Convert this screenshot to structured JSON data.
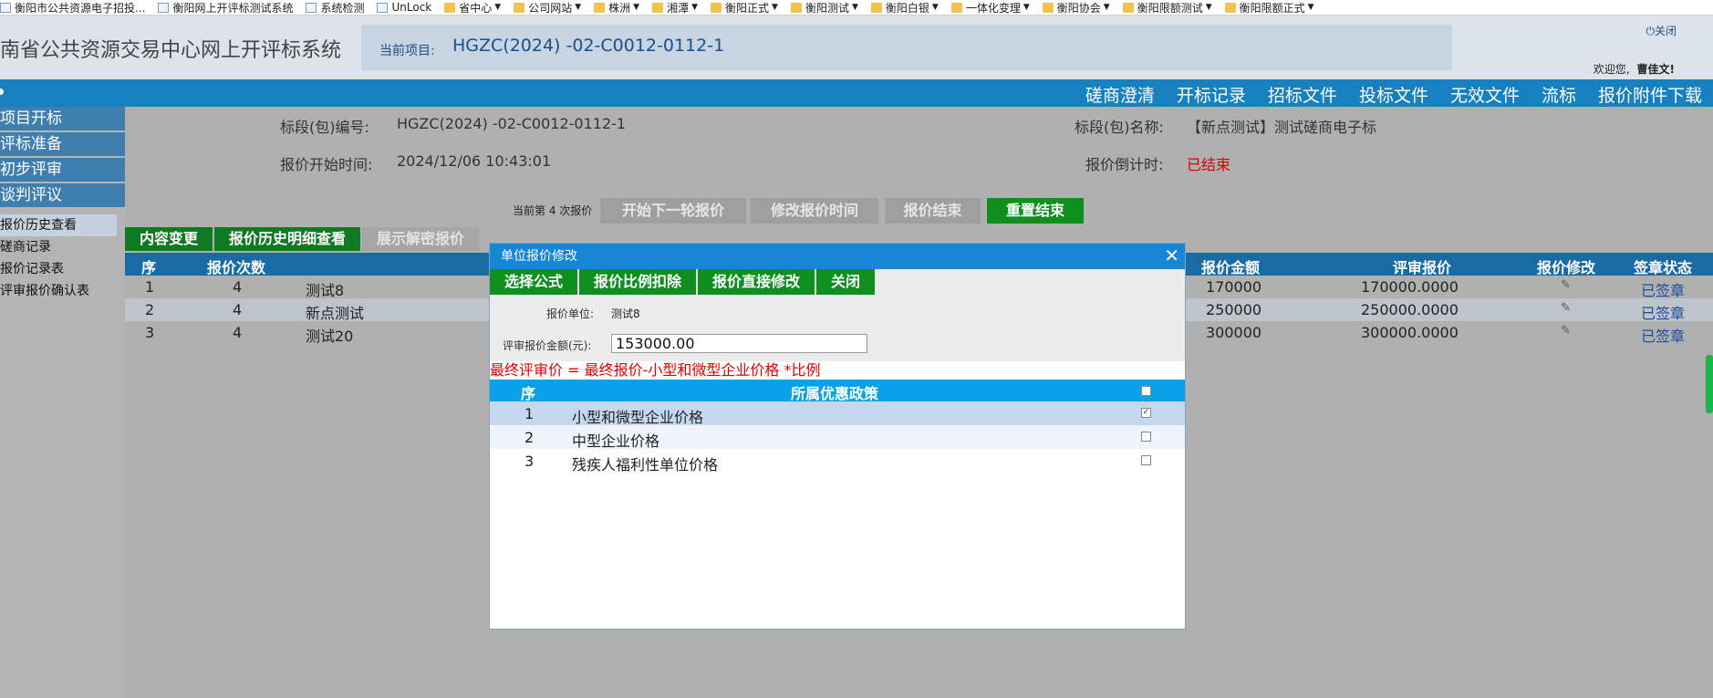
{
  "bookmarks": [
    {
      "label": "衡阳市公共资源电子招投...",
      "type": "page",
      "dropdown": false
    },
    {
      "label": "衡阳网上开评标测试系统",
      "type": "page",
      "dropdown": false
    },
    {
      "label": "系统检测",
      "type": "page",
      "dropdown": false
    },
    {
      "label": "UnLock",
      "type": "page",
      "dropdown": false
    },
    {
      "label": "省中心",
      "type": "folder",
      "dropdown": true
    },
    {
      "label": "公司网站",
      "type": "folder",
      "dropdown": true
    },
    {
      "label": "株洲",
      "type": "folder",
      "dropdown": true
    },
    {
      "label": "湘潭",
      "type": "folder",
      "dropdown": true
    },
    {
      "label": "衡阳正式",
      "type": "folder",
      "dropdown": true
    },
    {
      "label": "衡阳测试",
      "type": "folder",
      "dropdown": true
    },
    {
      "label": "衡阳白银",
      "type": "folder",
      "dropdown": true
    },
    {
      "label": "一体化变理",
      "type": "folder",
      "dropdown": true
    },
    {
      "label": "衡阳协会",
      "type": "folder",
      "dropdown": true
    },
    {
      "label": "衡阳限额测试",
      "type": "folder",
      "dropdown": true
    },
    {
      "label": "衡阳限额正式",
      "type": "folder",
      "dropdown": true
    }
  ],
  "header": {
    "system_title": "南省公共资源交易中心网上开评标系统",
    "project_label": "当前项目:",
    "project_code": "HGZC(2024) -02-C0012-0112-1",
    "close_label": "关闭",
    "welcome_label": "欢迎您,",
    "user_name": "曹佳文!"
  },
  "topnav": [
    "磋商澄清",
    "开标记录",
    "招标文件",
    "投标文件",
    "无效文件",
    "流标",
    "报价附件下载"
  ],
  "sidebar": {
    "sections": [
      "项目开标",
      "评标准备",
      "初步评审",
      "谈判评议"
    ],
    "links": [
      "报价历史查看",
      "磋商记录",
      "报价记录表",
      "评审报价确认表"
    ],
    "active_index": 0
  },
  "info": {
    "package_code_label": "标段(包)编号:",
    "package_code": "HGZC(2024) -02-C0012-0112-1",
    "package_name_label": "标段(包)名称:",
    "package_name": "【新点测试】测试磋商电子标",
    "start_time_label": "报价开始时间:",
    "start_time": "2024/12/06 10:43:01",
    "countdown_label": "报价倒计时:",
    "countdown": "已结束"
  },
  "round": {
    "text": "当前第 4 次报价",
    "buttons": [
      {
        "label": "开始下一轮报价",
        "enabled": false
      },
      {
        "label": "修改报价时间",
        "enabled": false
      },
      {
        "label": "报价结束",
        "enabled": false
      },
      {
        "label": "重置结束",
        "enabled": true
      }
    ]
  },
  "tabs": [
    {
      "label": "内容变更",
      "enabled": true
    },
    {
      "label": "报价历史明细查看",
      "enabled": true
    },
    {
      "label": "展示解密报价",
      "enabled": false
    }
  ],
  "bg_table": {
    "headers": [
      "序",
      "报价次数",
      "报价金额",
      "评审报价",
      "报价修改",
      "签章状态"
    ],
    "rows": [
      {
        "seq": "1",
        "count": "4",
        "name": "测试8",
        "amount": "170000",
        "review": "170000.0000",
        "status": "已签章"
      },
      {
        "seq": "2",
        "count": "4",
        "name": "新点测试",
        "amount": "250000",
        "review": "250000.0000",
        "status": "已签章"
      },
      {
        "seq": "3",
        "count": "4",
        "name": "测试20",
        "amount": "300000",
        "review": "300000.0000",
        "status": "已签章"
      }
    ]
  },
  "modal": {
    "title": "单位报价修改",
    "close_glyph": "✕",
    "buttons": [
      "选择公式",
      "报价比例扣除",
      "报价直接修改",
      "关闭"
    ],
    "unit_label": "报价单位:",
    "unit_value": "测试8",
    "amount_label": "评审报价金额(元):",
    "amount_value": "153000.00",
    "formula": "最终评审价 = 最终报价-小型和微型企业价格 *比例",
    "policy_headers": [
      "序",
      "所属优惠政策"
    ],
    "policies": [
      {
        "seq": "1",
        "name": "小型和微型企业价格",
        "checked": true
      },
      {
        "seq": "2",
        "name": "中型企业价格",
        "checked": false
      },
      {
        "seq": "3",
        "name": "残疾人福利性单位价格",
        "checked": false
      }
    ]
  },
  "colors": {
    "nav_blue": "#1780bf",
    "modal_title_blue": "#1786d6",
    "green_button": "#0e8f20",
    "policy_head_blue": "#09a2e8",
    "alert_red": "#e00000"
  }
}
